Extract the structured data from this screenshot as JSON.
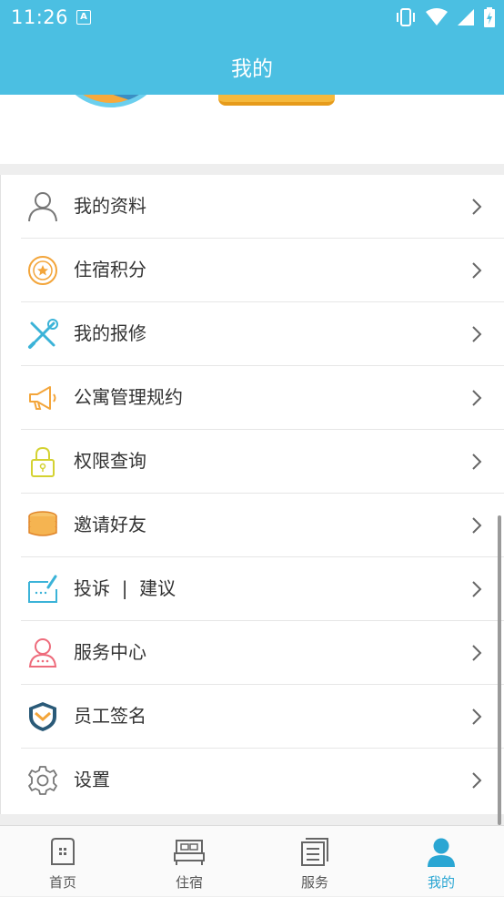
{
  "status_bar": {
    "time": "11:26",
    "notification_letter": "A"
  },
  "header": {
    "title": "我的"
  },
  "menu": {
    "items": [
      {
        "label": "我的资料",
        "icon": "user-icon"
      },
      {
        "label": "住宿积分",
        "icon": "points-icon"
      },
      {
        "label": "我的报修",
        "icon": "repair-tools-icon"
      },
      {
        "label": "公寓管理规约",
        "icon": "megaphone-icon"
      },
      {
        "label": "权限查询",
        "icon": "lock-icon"
      },
      {
        "label": "邀请好友",
        "icon": "coins-icon"
      },
      {
        "label": "投诉  |  建议",
        "icon": "feedback-icon"
      },
      {
        "label": "服务中心",
        "icon": "service-icon"
      },
      {
        "label": "员工签名",
        "icon": "shield-icon"
      },
      {
        "label": "设置",
        "icon": "gear-icon"
      }
    ]
  },
  "tabs": [
    {
      "label": "首页",
      "icon": "home-icon"
    },
    {
      "label": "住宿",
      "icon": "bed-icon"
    },
    {
      "label": "服务",
      "icon": "service-list-icon"
    },
    {
      "label": "我的",
      "icon": "person-icon",
      "active": true
    }
  ],
  "colors": {
    "primary": "#4bbfe2",
    "tab_active": "#2aa6d3"
  }
}
